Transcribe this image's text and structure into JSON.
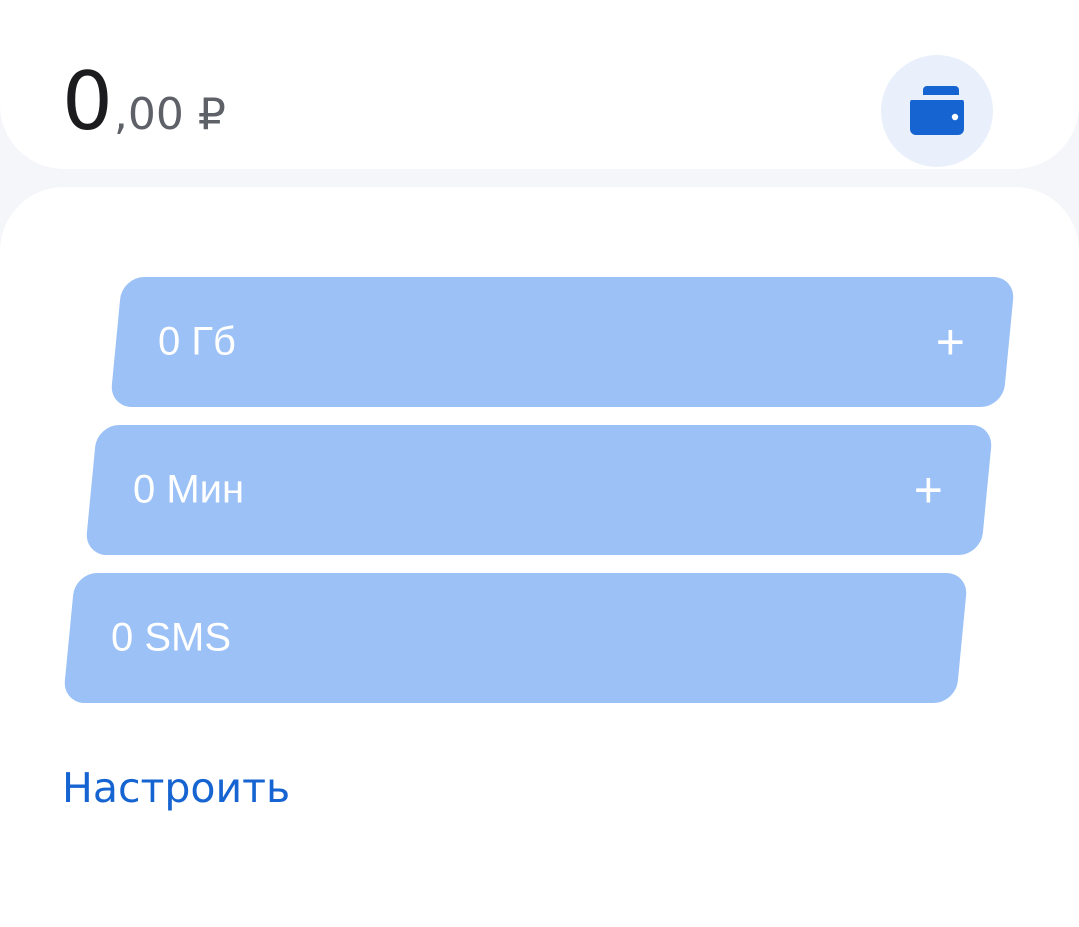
{
  "balance": {
    "integer": "0",
    "fraction": ",00 ₽"
  },
  "wallet": {
    "icon": "wallet-icon",
    "color": "#1664d2"
  },
  "plan": {
    "data_label": "0 Гб",
    "minutes_label": "0 Мин",
    "sms_label": "0 SMS",
    "add_symbol": "+",
    "configure_label": "Настроить"
  },
  "colors": {
    "pill": "#9bc1f6",
    "link": "#1664d2",
    "background": "#f5f6fa"
  }
}
